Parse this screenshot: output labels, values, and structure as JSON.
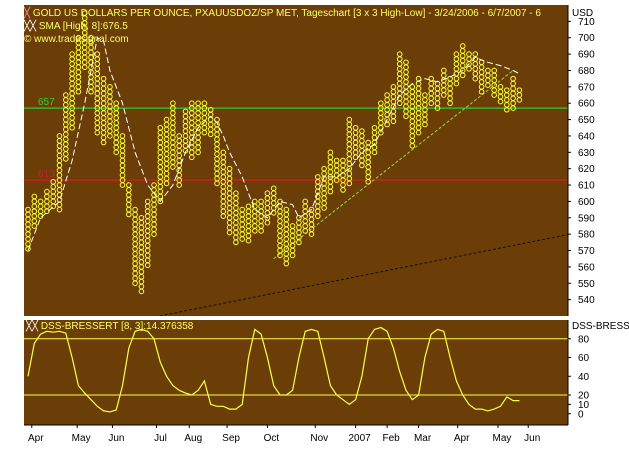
{
  "colors": {
    "panel_bg": "#6b3e08",
    "box": "#ffff33",
    "sma": "#ffffff",
    "level_high": "#33cc33",
    "level_low": "#cc2222",
    "oscillator": "#ffff44",
    "trend_up": "#99dd33",
    "trend_long": "#111111"
  },
  "header": {
    "title": "GOLD US DOLLARS PER OUNCE, PXAUUSDOZ/SP MET, Tageschart [3 x 3 High-Low] - 3/24/2006 - 6/7/2007 - 6",
    "currency": "USD",
    "sma_label": "SMA [High, 8]:676.5",
    "copyright": "© www.tradesignal.com"
  },
  "lower_panel": {
    "label": "DSS-BRESSERT [8, 3]:14.376358",
    "right_label": "DSS-BRESSI"
  },
  "chart_data": [
    {
      "type": "point-and-figure",
      "title": "GOLD US DOLLARS PER OUNCE, PXAUUSDOZ/SP MET, Tageschart [3 x 3 High-Low] - 3/24/2006 - 6/7/2007 - 6",
      "box_size": 3,
      "reversal": 3,
      "ylim": [
        530,
        720
      ],
      "yticks": [
        540,
        550,
        560,
        570,
        580,
        590,
        600,
        610,
        620,
        630,
        640,
        650,
        660,
        670,
        680,
        690,
        700,
        710
      ],
      "xticks": [
        "Apr",
        "May",
        "Jun",
        "Jul",
        "Aug",
        "Sep",
        "Oct",
        "Nov",
        "2007",
        "Feb",
        "Mar",
        "Apr",
        "May",
        "Jun"
      ],
      "xtick_pos": [
        0.6,
        7.8,
        13.4,
        20.4,
        25.6,
        31.6,
        38.0,
        45.6,
        52.0,
        57.0,
        62.0,
        68.2,
        74.6,
        79.4
      ],
      "horizontal_levels": [
        {
          "value": 657,
          "label": "657",
          "color": "#33cc33"
        },
        {
          "value": 613,
          "label": "613",
          "color": "#cc2222"
        }
      ],
      "columns": [
        [
          570,
          595
        ],
        [
          585,
          603
        ],
        [
          590,
          600
        ],
        [
          592,
          606
        ],
        [
          597,
          612
        ],
        [
          595,
          640
        ],
        [
          625,
          665
        ],
        [
          645,
          690
        ],
        [
          665,
          700
        ],
        [
          680,
          715
        ],
        [
          665,
          700
        ],
        [
          640,
          690
        ],
        [
          635,
          675
        ],
        [
          640,
          670
        ],
        [
          630,
          660
        ],
        [
          610,
          640
        ],
        [
          590,
          610
        ],
        [
          550,
          595
        ],
        [
          545,
          590
        ],
        [
          560,
          600
        ],
        [
          580,
          610
        ],
        [
          600,
          645
        ],
        [
          610,
          650
        ],
        [
          620,
          660
        ],
        [
          610,
          640
        ],
        [
          630,
          655
        ],
        [
          625,
          660
        ],
        [
          630,
          660
        ],
        [
          640,
          660
        ],
        [
          640,
          656
        ],
        [
          610,
          650
        ],
        [
          590,
          630
        ],
        [
          580,
          620
        ],
        [
          575,
          605
        ],
        [
          575,
          595
        ],
        [
          575,
          597
        ],
        [
          580,
          600
        ],
        [
          580,
          600
        ],
        [
          585,
          605
        ],
        [
          592,
          608
        ],
        [
          565,
          600
        ],
        [
          562,
          595
        ],
        [
          566,
          585
        ],
        [
          575,
          590
        ],
        [
          580,
          600
        ],
        [
          578,
          595
        ],
        [
          590,
          615
        ],
        [
          596,
          620
        ],
        [
          606,
          630
        ],
        [
          612,
          625
        ],
        [
          605,
          625
        ],
        [
          610,
          650
        ],
        [
          625,
          645
        ],
        [
          620,
          643
        ],
        [
          610,
          636
        ],
        [
          630,
          645
        ],
        [
          640,
          660
        ],
        [
          645,
          665
        ],
        [
          648,
          670
        ],
        [
          660,
          690
        ],
        [
          650,
          685
        ],
        [
          632,
          670
        ],
        [
          640,
          675
        ],
        [
          645,
          665
        ],
        [
          660,
          675
        ],
        [
          655,
          672
        ],
        [
          665,
          680
        ],
        [
          660,
          675
        ],
        [
          672,
          690
        ],
        [
          675,
          695
        ],
        [
          680,
          690
        ],
        [
          675,
          690
        ],
        [
          665,
          685
        ],
        [
          670,
          680
        ],
        [
          665,
          680
        ],
        [
          660,
          670
        ],
        [
          655,
          668
        ],
        [
          655,
          675
        ],
        [
          660,
          668
        ]
      ],
      "sma": [
        [
          0,
          570
        ],
        [
          2,
          590
        ],
        [
          5,
          600
        ],
        [
          7,
          625
        ],
        [
          9,
          660
        ],
        [
          11,
          700
        ],
        [
          12,
          698
        ],
        [
          13,
          680
        ],
        [
          15,
          660
        ],
        [
          17,
          630
        ],
        [
          19,
          610
        ],
        [
          21,
          600
        ],
        [
          23,
          610
        ],
        [
          25,
          630
        ],
        [
          27,
          645
        ],
        [
          29,
          652
        ],
        [
          30,
          648
        ],
        [
          31,
          640
        ],
        [
          32,
          630
        ],
        [
          34,
          615
        ],
        [
          36,
          595
        ],
        [
          38,
          590
        ],
        [
          40,
          600
        ],
        [
          42,
          598
        ],
        [
          43,
          590
        ],
        [
          45,
          595
        ],
        [
          47,
          615
        ],
        [
          49,
          615
        ],
        [
          51,
          620
        ],
        [
          53,
          630
        ],
        [
          55,
          635
        ],
        [
          57,
          650
        ],
        [
          59,
          665
        ],
        [
          61,
          672
        ],
        [
          63,
          675
        ],
        [
          65,
          673
        ],
        [
          67,
          676
        ],
        [
          69,
          680
        ],
        [
          71,
          688
        ],
        [
          73,
          685
        ],
        [
          75,
          683
        ],
        [
          77,
          680
        ],
        [
          78,
          678
        ]
      ],
      "trendlines": [
        {
          "from": [
            39,
            565
          ],
          "to": [
            77,
            680
          ],
          "style": "dashed",
          "color": "#99dd33"
        },
        {
          "from": [
            17,
            527
          ],
          "to": [
            86,
            580
          ],
          "style": "dashed",
          "color": "#111111"
        }
      ]
    },
    {
      "type": "line",
      "name": "DSS-BRESSERT [8, 3]",
      "ylim": [
        -12,
        100
      ],
      "yticks": [
        0,
        10,
        20,
        40,
        60,
        80
      ],
      "horizontal_levels": [
        80,
        20
      ],
      "x": [
        0,
        1,
        2,
        3,
        4,
        5,
        6,
        7,
        8,
        9,
        10,
        11,
        12,
        13,
        14,
        15,
        16,
        17,
        18,
        19,
        20,
        21,
        22,
        23,
        24,
        25,
        26,
        27,
        28,
        29,
        30,
        31,
        32,
        33,
        34,
        35,
        36,
        37,
        38,
        39,
        40,
        41,
        42,
        43,
        44,
        45,
        46,
        47,
        48,
        49,
        50,
        51,
        52,
        53,
        54,
        55,
        56,
        57,
        58,
        59,
        60,
        61,
        62,
        63,
        64,
        65,
        66,
        67,
        68,
        69,
        70,
        71,
        72,
        73,
        74,
        75,
        76,
        77,
        78
      ],
      "values": [
        40,
        75,
        85,
        88,
        87,
        88,
        86,
        60,
        30,
        22,
        15,
        8,
        3,
        2,
        4,
        30,
        70,
        88,
        90,
        88,
        80,
        55,
        40,
        30,
        25,
        22,
        20,
        25,
        35,
        10,
        8,
        8,
        5,
        5,
        10,
        60,
        90,
        85,
        60,
        30,
        20,
        20,
        25,
        60,
        88,
        90,
        88,
        60,
        30,
        20,
        15,
        10,
        15,
        40,
        80,
        90,
        92,
        88,
        70,
        45,
        25,
        15,
        20,
        60,
        85,
        90,
        88,
        60,
        35,
        20,
        10,
        5,
        5,
        3,
        5,
        8,
        18,
        14,
        14
      ]
    }
  ]
}
